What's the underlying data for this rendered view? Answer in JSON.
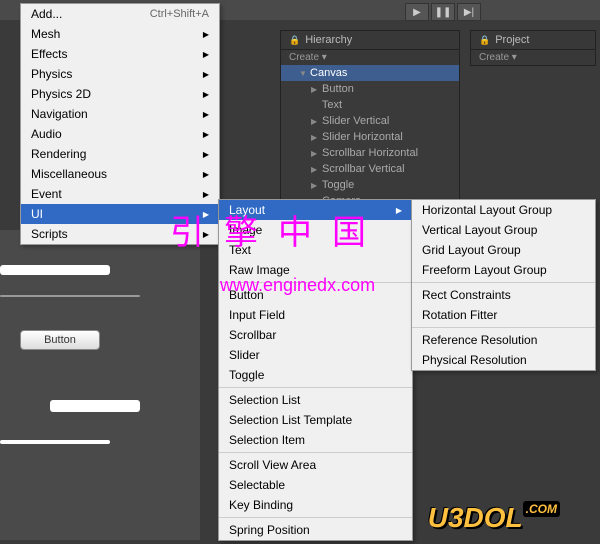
{
  "playbar": {
    "play": "▶",
    "pause": "❚❚",
    "next": "▶|"
  },
  "hierarchy": {
    "title": "Hierarchy",
    "create": "Create ▾",
    "items": [
      {
        "label": "Canvas",
        "selected": true,
        "arrow": "▼"
      },
      {
        "label": "Button",
        "child": true,
        "arrow": "▶"
      },
      {
        "label": "Text",
        "child": true,
        "arrow": ""
      },
      {
        "label": "Slider Vertical",
        "child": true,
        "arrow": "▶"
      },
      {
        "label": "Slider Horizontal",
        "child": true,
        "arrow": "▶"
      },
      {
        "label": "Scrollbar Horizontal",
        "child": true,
        "arrow": "▶"
      },
      {
        "label": "Scrollbar Vertical",
        "child": true,
        "arrow": "▶"
      },
      {
        "label": "Toggle",
        "child": true,
        "arrow": "▶"
      },
      {
        "label": "Camera",
        "child": true,
        "arrow": ""
      }
    ]
  },
  "project": {
    "title": "Project",
    "create": "Create ▾"
  },
  "menu1": {
    "items": [
      {
        "label": "Add...",
        "shortcut": "Ctrl+Shift+A"
      },
      {
        "label": "Mesh",
        "sub": true
      },
      {
        "label": "Effects",
        "sub": true
      },
      {
        "label": "Physics",
        "sub": true
      },
      {
        "label": "Physics 2D",
        "sub": true
      },
      {
        "label": "Navigation",
        "sub": true
      },
      {
        "label": "Audio",
        "sub": true
      },
      {
        "label": "Rendering",
        "sub": true
      },
      {
        "label": "Miscellaneous",
        "sub": true
      },
      {
        "label": "Event",
        "sub": true
      },
      {
        "label": "UI",
        "sub": true,
        "hl": true
      },
      {
        "label": "Scripts",
        "sub": true
      }
    ]
  },
  "menu2": {
    "groups": [
      [
        {
          "label": "Layout",
          "sub": true,
          "hl": true
        },
        {
          "label": "Image"
        },
        {
          "label": "Text"
        },
        {
          "label": "Raw Image"
        }
      ],
      [
        {
          "label": "Button"
        },
        {
          "label": "Input Field"
        },
        {
          "label": "Scrollbar"
        },
        {
          "label": "Slider"
        },
        {
          "label": "Toggle"
        }
      ],
      [
        {
          "label": "Selection List"
        },
        {
          "label": "Selection List Template"
        },
        {
          "label": "Selection Item"
        }
      ],
      [
        {
          "label": "Scroll View Area"
        },
        {
          "label": "Selectable"
        },
        {
          "label": "Key Binding"
        }
      ],
      [
        {
          "label": "Spring Position"
        }
      ]
    ]
  },
  "menu3": {
    "groups": [
      [
        {
          "label": "Horizontal Layout Group"
        },
        {
          "label": "Vertical Layout Group"
        },
        {
          "label": "Grid Layout Group"
        },
        {
          "label": "Freeform Layout Group"
        }
      ],
      [
        {
          "label": "Rect Constraints"
        },
        {
          "label": "Rotation Fitter"
        }
      ],
      [
        {
          "label": "Reference Resolution"
        },
        {
          "label": "Physical Resolution"
        }
      ]
    ]
  },
  "scene": {
    "button_label": "Button"
  },
  "watermark": {
    "cn": "引擎中国",
    "url": "www.enginedx.com"
  },
  "logo": {
    "text": "U3DOL",
    "suffix": ".COM"
  }
}
